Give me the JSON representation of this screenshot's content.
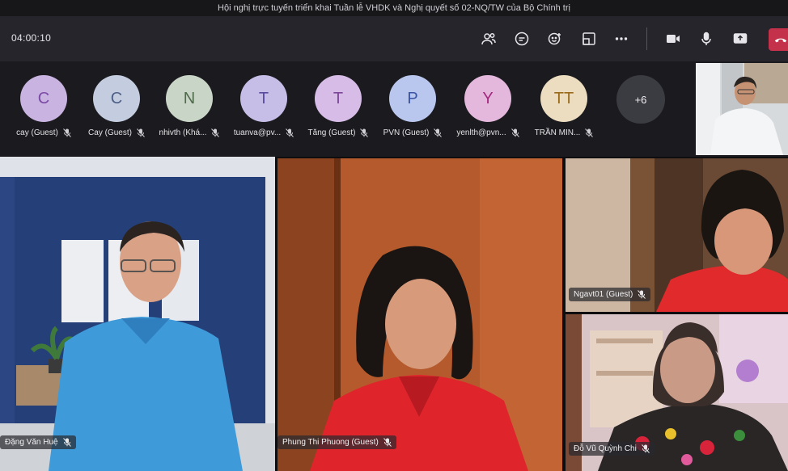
{
  "window": {
    "title": "Hội nghị trực tuyến triển khai Tuần lễ VHDK và Nghị quyết số 02-NQ/TW của Bộ Chính trị"
  },
  "toolbar": {
    "timer": "04:00:10",
    "icons": [
      "people-icon",
      "chat-icon",
      "reactions-icon",
      "rooms-icon",
      "more-icon",
      "camera-icon",
      "mic-icon",
      "share-icon",
      "hangup-icon"
    ]
  },
  "participants": [
    {
      "initial": "C",
      "name": "cay (Guest)",
      "color": "#c9b3e0",
      "text_color": "#7b4aa6"
    },
    {
      "initial": "C",
      "name": "Cay (Guest)",
      "color": "#c4cde0",
      "text_color": "#4d5f86"
    },
    {
      "initial": "N",
      "name": "nhivth (Khá...",
      "color": "#c9d5c7",
      "text_color": "#4f6b4b"
    },
    {
      "initial": "T",
      "name": "tuanva@pv...",
      "color": "#c7bee8",
      "text_color": "#5b4a9e"
    },
    {
      "initial": "T",
      "name": "Tăng (Guest)",
      "color": "#d6bce6",
      "text_color": "#7d4699"
    },
    {
      "initial": "P",
      "name": "PVN (Guest)",
      "color": "#b9c6ee",
      "text_color": "#3954a3"
    },
    {
      "initial": "Y",
      "name": "yenlth@pvn...",
      "color": "#e4b8dc",
      "text_color": "#a4287f"
    },
    {
      "initial": "TT",
      "name": "TRẦN MIN...",
      "color": "#ecdcc0",
      "text_color": "#9a6a1a"
    }
  ],
  "overflow": {
    "label": "+6"
  },
  "videos": [
    {
      "name": "Đặng Văn Huệ"
    },
    {
      "name": "Phung Thi Phuong (Guest)"
    },
    {
      "name": "Ngavt01 (Guest)"
    },
    {
      "name": "Đỗ Vũ Quỳnh Chi"
    }
  ],
  "colors": {
    "toolbar_bg": "#25252b",
    "strip_bg": "#1b1b1f",
    "hangup": "#c4314b"
  }
}
